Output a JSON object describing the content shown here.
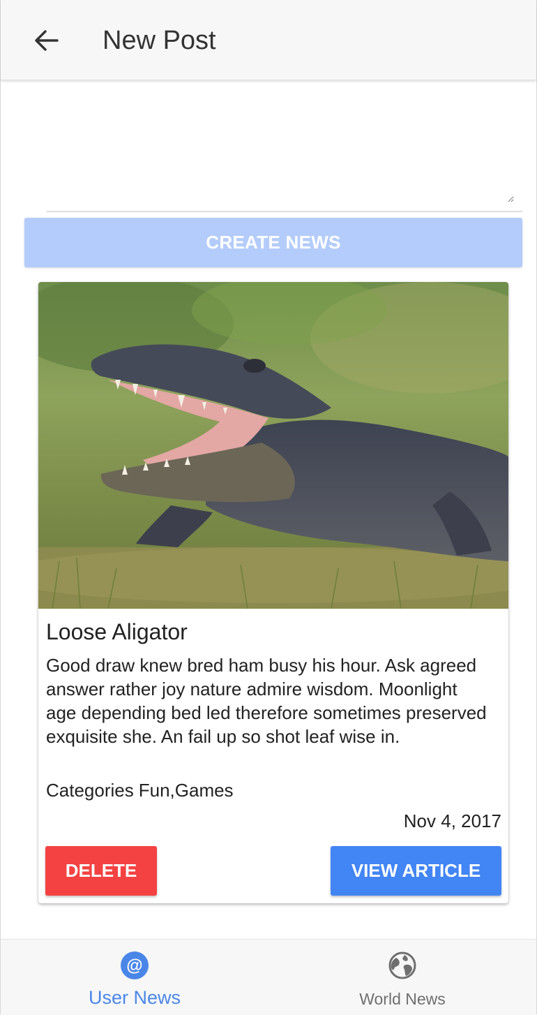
{
  "header": {
    "title": "New Post",
    "back_icon": "arrow-left-icon"
  },
  "composer": {
    "textarea_value": "",
    "textarea_placeholder": "",
    "create_label": "CREATE NEWS"
  },
  "card": {
    "image_alt": "Alligator with open jaws on grass",
    "title": "Loose Aligator",
    "body": "Good draw knew bred ham busy his hour. Ask agreed answer rather joy nature admire wisdom. Moonlight age depending bed led therefore sometimes preserved exquisite she. An fail up so shot leaf wise in.",
    "categories_label": "Categories",
    "categories_value": "Fun,Games",
    "date": "Nov 4, 2017",
    "delete_label": "DELETE",
    "view_label": "VIEW ARTICLE"
  },
  "bottom_nav": {
    "items": [
      {
        "label": "User News",
        "icon": "at-sign-icon",
        "active": true
      },
      {
        "label": "World News",
        "icon": "globe-icon",
        "active": false
      }
    ]
  },
  "colors": {
    "primary": "#4285f4",
    "primary_disabled": "#b3ccfb",
    "danger": "#f44242",
    "active_nav": "#4a86e8",
    "inactive_nav": "#6f6f6f"
  }
}
